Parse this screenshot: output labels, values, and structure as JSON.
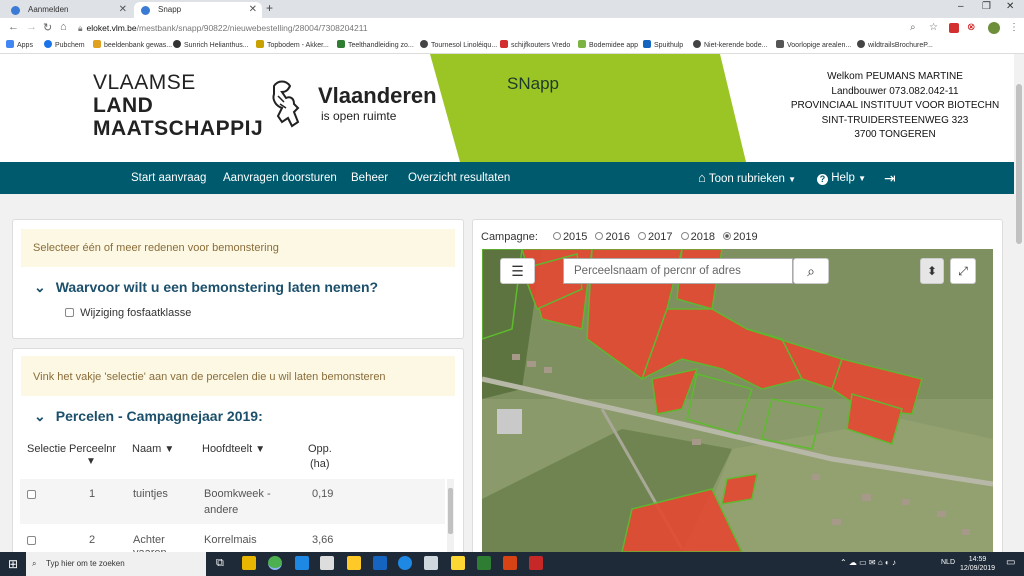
{
  "browser": {
    "tabs": [
      {
        "label": "Aanmelden"
      },
      {
        "label": "Snapp"
      }
    ],
    "url_domain": "eloket.vlm.be",
    "url_path": "/mestbank/snapp/90822/nieuwebestelling/28004/7308204211",
    "bookmarks": [
      {
        "label": "Apps",
        "color": "#4285f4"
      },
      {
        "label": "Pubchem",
        "color": "#1a73e8"
      },
      {
        "label": "beeldenbank gewas...",
        "color": "#e0a020"
      },
      {
        "label": "Sunrich Helianthus...",
        "color": "#333333"
      },
      {
        "label": "Topbodem - Akker...",
        "color": "#c8a000"
      },
      {
        "label": "Teelthandleiding zo...",
        "color": "#2e7d32"
      },
      {
        "label": "Tournesol Linoléiqu...",
        "color": "#444444"
      },
      {
        "label": "schijfkouters Vredo",
        "color": "#d32f2f"
      },
      {
        "label": "Bodemidee app",
        "color": "#7cb342"
      },
      {
        "label": "Spuithulp",
        "color": "#1565c0"
      },
      {
        "label": "Niet-kerende bode...",
        "color": "#444444"
      },
      {
        "label": "Voorlopige arealen...",
        "color": "#555555"
      },
      {
        "label": "wildtrailsBrochureP...",
        "color": "#444444"
      }
    ]
  },
  "header": {
    "logo_line1": "VLAAMSE",
    "logo_line2": "LAND",
    "logo_line3": "MAATSCHAPPIJ",
    "vl_name": "Vlaanderen",
    "vl_sub": "is open ruimte",
    "app_title": "SNapp",
    "welcome_lines": [
      "Welkom PEUMANS MARTINE",
      "Landbouwer 073.082.042-11",
      "PROVINCIAAL INSTITUUT VOOR BIOTECHN",
      "SINT-TRUIDERSTEENWEG 323",
      "3700 TONGEREN"
    ],
    "green_color": "#9bc525",
    "nav_color": "#005a6e"
  },
  "nav": {
    "start": "Start aanvraag",
    "forward": "Aanvragen doorsturen",
    "manage": "Beheer",
    "results": "Overzicht resultaten",
    "show_categories": "Toon rubrieken",
    "help": "Help"
  },
  "reasons": {
    "alert": "Selecteer één of meer redenen voor bemonstering",
    "title": "Waarvoor wilt u een bemonstering laten nemen?",
    "option": "Wijziging fosfaatklasse"
  },
  "parcels": {
    "alert": "Vink het vakje 'selectie' aan van de percelen die u wil laten bemonsteren",
    "title": "Percelen - Campagnejaar 2019:",
    "columns": {
      "selection": "Selectie",
      "number": "Perceelnr",
      "name": "Naam",
      "crop": "Hoofdteelt",
      "area_line1": "Opp.",
      "area_line2": "(ha)"
    },
    "rows": [
      {
        "nr": "1",
        "name": "tuintjes",
        "crop_line1": "Boomkweek -",
        "crop_line2": "andere",
        "area": "0,19"
      },
      {
        "nr": "2",
        "name": "Achter",
        "name_line2": "vaaren",
        "crop_line1": "Korrelmais",
        "crop_line2": "",
        "area": "3,66"
      }
    ]
  },
  "map": {
    "campaign_label": "Campagne:",
    "years": [
      "2015",
      "2016",
      "2017",
      "2018",
      "2019"
    ],
    "selected_year": "2019",
    "search_placeholder": "Perceelsnaam of percnr of adres"
  },
  "taskbar": {
    "search_placeholder": "Typ hier om te zoeken",
    "lang": "NLD",
    "time": "14:59",
    "date": "12/09/2019"
  }
}
